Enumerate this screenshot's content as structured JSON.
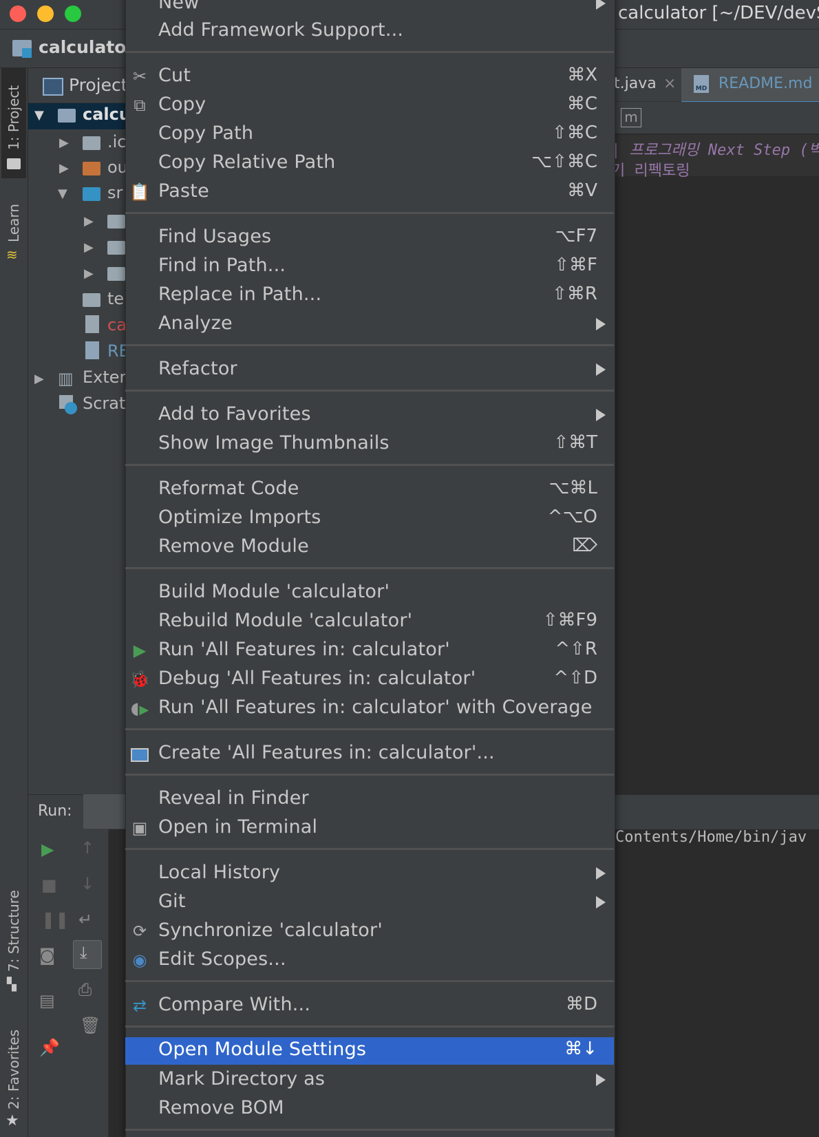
{
  "window": {
    "title": "calculator [~/DEV/devStu"
  },
  "navbar": {
    "label": "calculator"
  },
  "left_strip": {
    "tab1": "1: Project",
    "tab2": "Learn",
    "tab3": "7: Structure",
    "tab4": "2: Favorites"
  },
  "project": {
    "header": "Project",
    "items": [
      {
        "label": "calcu",
        "color": "#bbbbbb"
      },
      {
        "label": ".ic",
        "color": "#bbbbbb"
      },
      {
        "label": "ou",
        "color": "#bbbbbb"
      },
      {
        "label": "sr",
        "color": "#bbbbbb"
      },
      {
        "label": "",
        "color": "#bbbbbb"
      },
      {
        "label": "",
        "color": "#bbbbbb"
      },
      {
        "label": "",
        "color": "#bbbbbb"
      },
      {
        "label": "te",
        "color": "#bbbbbb"
      },
      {
        "label": "ca",
        "color": "#d25252"
      },
      {
        "label": "RE",
        "color": "#6897bb"
      },
      {
        "label": "Exter",
        "color": "#bbbbbb"
      },
      {
        "label": "Scrat",
        "color": "#bbbbbb"
      }
    ]
  },
  "editor": {
    "tabs": [
      {
        "label": "t.java"
      },
      {
        "label": "README.md",
        "badge": "MD"
      }
    ],
    "toolbar_glyph": "m",
    "lines": [
      "| 프로그래밍 Next Step (벽",
      "기 리펙토링"
    ]
  },
  "run": {
    "label": "Run:",
    "console_text": "Contents/Home/bin/jav"
  },
  "menu": {
    "top_partial": "New",
    "items": [
      {
        "label": "Add Framework Support...",
        "shortcut": ""
      },
      {
        "label": "Cut",
        "shortcut": "⌘X",
        "icon": "✂"
      },
      {
        "label": "Copy",
        "shortcut": "⌘C",
        "icon": "⧉"
      },
      {
        "label": "Copy Path",
        "shortcut": "⇧⌘C"
      },
      {
        "label": "Copy Relative Path",
        "shortcut": "⌥⇧⌘C"
      },
      {
        "label": "Paste",
        "shortcut": "⌘V",
        "icon": "📋"
      },
      {
        "label": "Find Usages",
        "shortcut": "⌥F7"
      },
      {
        "label": "Find in Path...",
        "shortcut": "⇧⌘F"
      },
      {
        "label": "Replace in Path...",
        "shortcut": "⇧⌘R"
      },
      {
        "label": "Analyze",
        "shortcut": ""
      },
      {
        "label": "Refactor",
        "shortcut": ""
      },
      {
        "label": "Add to Favorites",
        "shortcut": ""
      },
      {
        "label": "Show Image Thumbnails",
        "shortcut": "⇧⌘T"
      },
      {
        "label": "Reformat Code",
        "shortcut": "⌥⌘L"
      },
      {
        "label": "Optimize Imports",
        "shortcut": "^⌥O"
      },
      {
        "label": "Remove Module",
        "shortcut": "⌦"
      },
      {
        "label": "Build Module 'calculator'",
        "shortcut": ""
      },
      {
        "label": "Rebuild Module 'calculator'",
        "shortcut": "⇧⌘F9"
      },
      {
        "label": "Run 'All Features in: calculator'",
        "shortcut": "^⇧R",
        "icon": "▶"
      },
      {
        "label": "Debug 'All Features in: calculator'",
        "shortcut": "^⇧D",
        "icon": "🐞"
      },
      {
        "label": "Run 'All Features in: calculator' with Coverage",
        "shortcut": ""
      },
      {
        "label": "Create 'All Features in: calculator'...",
        "shortcut": ""
      },
      {
        "label": "Reveal in Finder",
        "shortcut": ""
      },
      {
        "label": "Open in Terminal",
        "shortcut": "",
        "icon": "▣"
      },
      {
        "label": "Local History",
        "shortcut": ""
      },
      {
        "label": "Git",
        "shortcut": ""
      },
      {
        "label": "Synchronize 'calculator'",
        "shortcut": "",
        "icon": "⟳"
      },
      {
        "label": "Edit Scopes...",
        "shortcut": "",
        "icon": "◉"
      },
      {
        "label": "Compare With...",
        "shortcut": "⌘D",
        "icon": "⇄"
      },
      {
        "label": "Open Module Settings",
        "shortcut": "⌘↓"
      },
      {
        "label": "Mark Directory as",
        "shortcut": ""
      },
      {
        "label": "Remove BOM",
        "shortcut": ""
      }
    ]
  },
  "colors": {
    "selection": "#2f65ca",
    "menu_bg": "#3c3f41",
    "editor_bg": "#2b2b2b",
    "run_green": "#499c54",
    "keyword_purple": "#9876aa"
  }
}
